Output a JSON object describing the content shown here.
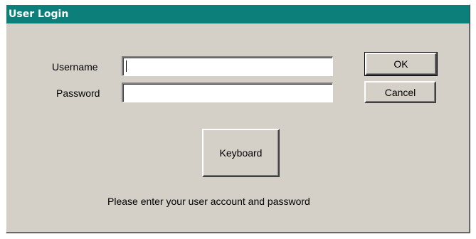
{
  "window": {
    "title": "User Login"
  },
  "form": {
    "username_label": "Username",
    "username_value": "",
    "password_label": "Password",
    "password_value": ""
  },
  "buttons": {
    "ok_label": "OK",
    "cancel_label": "Cancel",
    "keyboard_label": "Keyboard"
  },
  "status": {
    "message": "Please enter your user account and password"
  }
}
